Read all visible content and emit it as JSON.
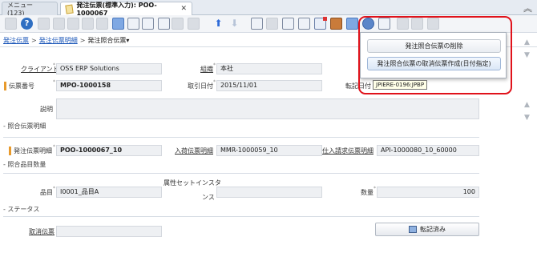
{
  "tabs": {
    "menu_label": "メニュー (123)",
    "active_label": "発注伝票(標準入力): POO-1000067",
    "close_glyph": "✕"
  },
  "window": {
    "collapse_glyph": "︽"
  },
  "breadcrumb": {
    "items": [
      "発注伝票",
      "発注伝票明細",
      "発注照合伝票▾"
    ],
    "separator": ">"
  },
  "form": {
    "client": {
      "label": "クライアント",
      "value": "OSS ERP Solutions"
    },
    "org": {
      "label": "組織",
      "value": "本社"
    },
    "doc_no": {
      "label": "伝票番号",
      "value": "MPO-1000158"
    },
    "trx_date": {
      "label": "取引日付",
      "value": "2015/11/01"
    },
    "acct_date": {
      "label": "転記日付"
    },
    "description": {
      "label": "説明",
      "value": ""
    },
    "section_match_lines": "- 照合伝票明細",
    "po_line": {
      "label": "発注伝票明細",
      "value": "POO-1000067_10"
    },
    "receipt_line": {
      "label": "入荷伝票明細",
      "value": "MMR-1000059_10"
    },
    "invoice_line": {
      "label": "仕入請求伝票明細",
      "value": "API-1000080_10_60000"
    },
    "section_product_qty": "- 照合品目数量",
    "product": {
      "label": "品目",
      "value": "I0001_品目A"
    },
    "asi": {
      "label_line1": "属性セットインスタ",
      "label_line2": "ンス"
    },
    "qty": {
      "label": "数量",
      "value": "100"
    },
    "section_status": "- ステータス",
    "reversal": {
      "label": "取消伝票"
    },
    "posted_button": "転記済み"
  },
  "popup": {
    "items": [
      "発注照合伝票の削除",
      "発注照合伝票の取消伝票作成(日付指定)"
    ],
    "tooltip": "JPIERE-0196:JPBP"
  },
  "icons": {
    "help": "?",
    "up": "⬆",
    "down": "⬇",
    "scroll_up": "▲",
    "scroll_down": "▼"
  },
  "colors": {
    "link": "#1a56b8",
    "required_marker": "#e89a2c",
    "highlight_ring": "#e0121b",
    "field_bg": "#eef0f3"
  }
}
